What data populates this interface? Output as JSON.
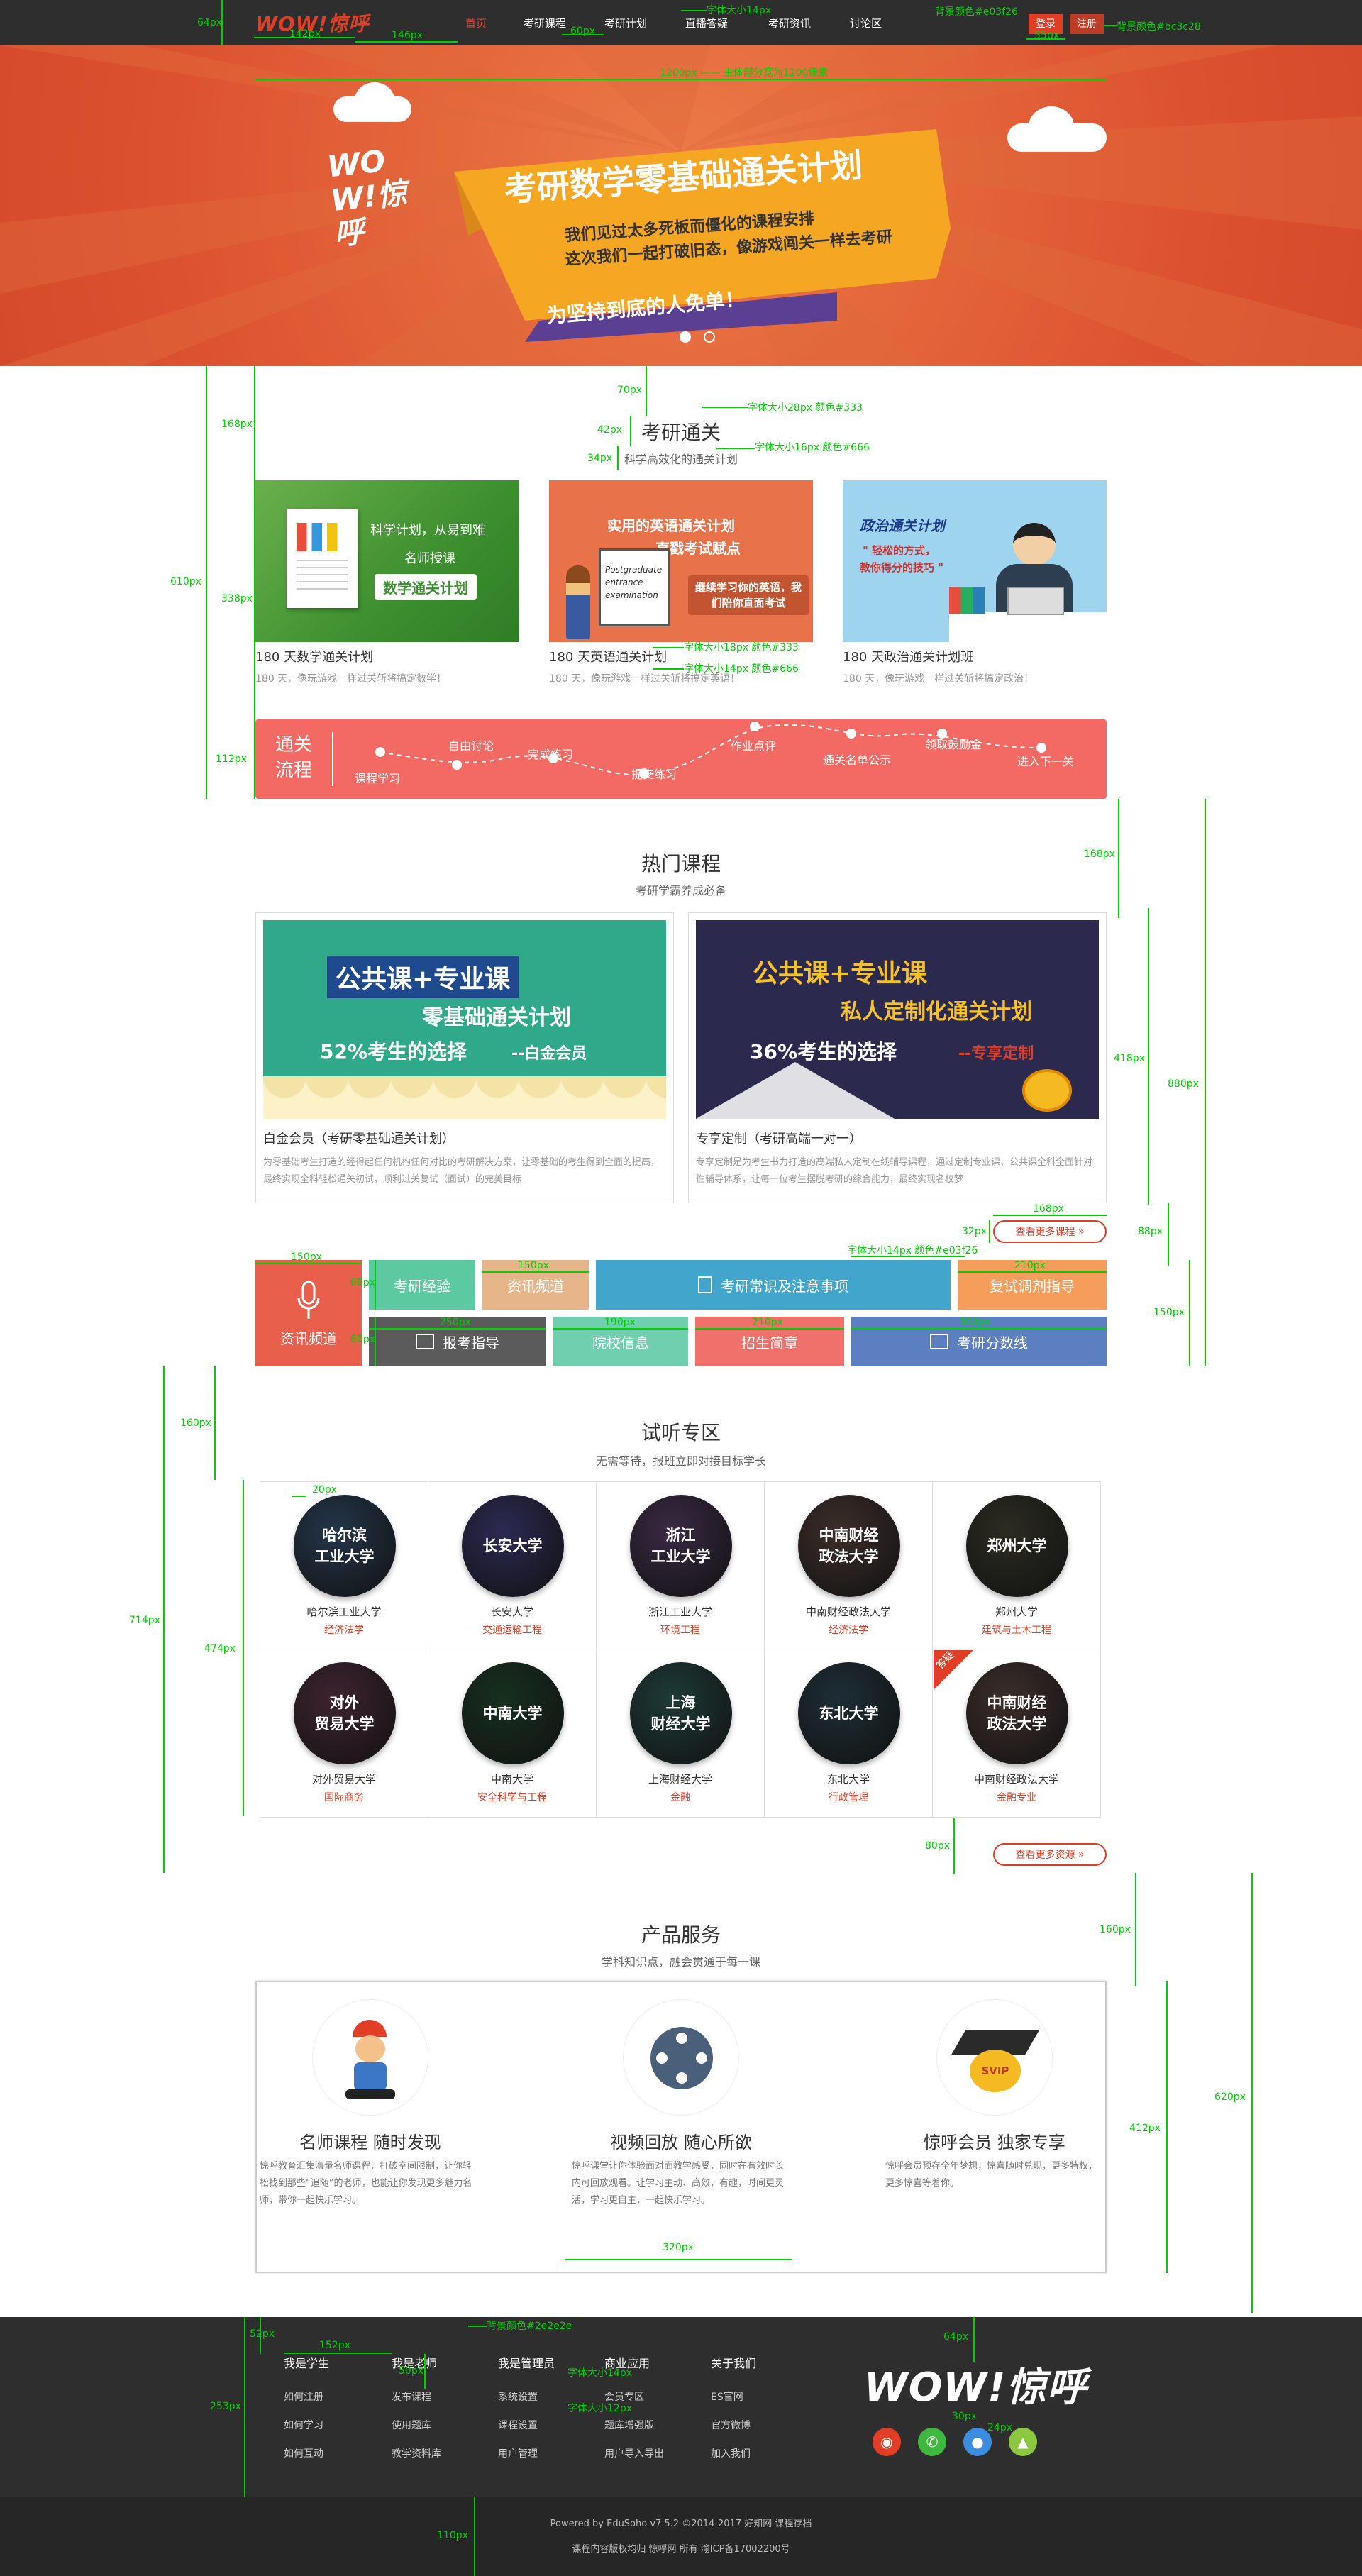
{
  "header": {
    "logo": "WOW!惊呼",
    "nav": [
      "首页",
      "考研课程",
      "考研计划",
      "直播答疑",
      "考研资讯",
      "讨论区"
    ],
    "login": "登录",
    "register": "注册"
  },
  "banner": {
    "title": "考研数学零基础通关计划",
    "line1": "我们见过太多死板而僵化的课程安排",
    "line2": "这次我们一起打破旧态，像游戏闯关一样去考研",
    "ribbon": "为坚持到底的人免单！",
    "logo": "WOW!惊呼"
  },
  "annotations": {
    "m1": "64px",
    "m2": "142px",
    "m3": "146px",
    "m4": "字体大小14px",
    "m5": "60px",
    "m6": "背景颜色#e03f26",
    "m7": "背景颜色#bc3c28",
    "m8": "55px",
    "m9": "1200px —— 主体部分宽为1200像素",
    "m10": "70px",
    "m11": "字体大小28px 颜色#333",
    "m12": "42px",
    "m13": "字体大小16px 颜色#666",
    "m14": "34px",
    "m15": "168px",
    "m16": "610px",
    "m17": "338px",
    "m18": "字体大小18px 颜色#333",
    "m19": "字体大小14px 颜色#666",
    "m20": "112px",
    "m21": "168px",
    "m22": "418px",
    "m23": "880px",
    "m24": "168px",
    "m25": "32px",
    "m26": "88px",
    "m27": "150px",
    "m28": "150px",
    "m29": "210px",
    "m30": "字体大小14px 颜色#e03f26",
    "m31": "150px",
    "m32": "60px",
    "m33": "60px",
    "m34": "250px",
    "m35": "190px",
    "m36": "210px",
    "m37": "360px",
    "m38": "160px",
    "m39": "20px",
    "m40": "714px",
    "m41": "474px",
    "m42": "80px",
    "m43": "160px",
    "m44": "412px",
    "m45": "620px",
    "m46": "320px",
    "m47": "52px",
    "m48": "背景颜色#2e2e2e",
    "m49": "152px",
    "m50": "50px",
    "m51": "字体大小14px",
    "m52": "253px",
    "m53": "字体大小12px",
    "m54": "64px",
    "m55": "30px",
    "m56": "24px",
    "m57": "110px"
  },
  "kaoyan": {
    "title": "考研通关",
    "subtitle": "科学高效化的通关计划",
    "cards": [
      {
        "img_title": "科学计划，从易到难",
        "img_line2": "名师授课",
        "img_tag": "数学通关计划",
        "title": "180 天数学通关计划",
        "desc": "180 天，像玩游戏一样过关斩将搞定数学！"
      },
      {
        "img_title": "实用的英语通关计划",
        "img_line2": "直戳考试赋点",
        "img_tag": "继续学习你的英语，我们陪你直面考试",
        "board": "Postgraduate entrance examination",
        "title": "180 天英语通关计划",
        "desc": "180 天，像玩游戏一样过关斩将搞定英语！"
      },
      {
        "img_title": "政治通关计划",
        "img_line2": "\" 轻松的方式，",
        "img_tag": "教你得分的技巧 \"",
        "title": "180 天政治通关计划班",
        "desc": "180 天，像玩游戏一样过关斩将搞定政治！"
      }
    ],
    "flow": {
      "label": "通关\n流程",
      "steps": [
        "课程学习",
        "自由讨论",
        "完成练习",
        "提交练习",
        "作业点评",
        "通关名单公示",
        "领取鼓励金",
        "进入下一关"
      ]
    }
  },
  "hot": {
    "title": "热门课程",
    "subtitle": "考研学霸养成必备",
    "cards": [
      {
        "banner_l1": "公共课+专业课",
        "banner_l2": "零基础通关计划",
        "banner_l3": "52%考生的选择",
        "banner_l4": "--白金会员",
        "title": "白金会员（考研零基础通关计划）",
        "desc": "为零基础考生打造的经得起任何机构任何对比的考研解决方案，让零基础的考生得到全面的提高，最终实现全科轻松通关初试，顺利过关复试（面试）的完美目标"
      },
      {
        "banner_l1": "公共课+专业课",
        "banner_l2": "私人定制化通关计划",
        "banner_l3": "36%考生的选择",
        "banner_l4": "--专享定制",
        "title": "专享定制（考研高端一对一）",
        "desc": "专享定制是为考生书力打造的高端私人定制在线辅导课程，通过定制专业课、公共课全科全面针对性辅导体系，让每一位考生摆脱考研的综合能力，最终实现名校梦"
      }
    ],
    "more": "查看更多课程",
    "tiles": {
      "big": "资讯频道",
      "r1": [
        "考研经验",
        "资讯频道",
        "考研常识及注意事项",
        "复试调剂指导"
      ],
      "r2": [
        "报考指导",
        "院校信息",
        "招生简章",
        "考研分数线"
      ]
    }
  },
  "trial": {
    "title": "试听专区",
    "subtitle": "无需等待，报班立即对接目标学长",
    "schools": [
      {
        "logo": "哈尔滨\n工业大学",
        "name": "哈尔滨工业大学",
        "major": "经济法学",
        "color": "#24364a"
      },
      {
        "logo": "长安大学",
        "name": "长安大学",
        "major": "交通运输工程",
        "color": "#2b2a52"
      },
      {
        "logo": "浙江\n工业大学",
        "name": "浙江工业大学",
        "major": "环境工程",
        "color": "#3a2a44"
      },
      {
        "logo": "中南财经\n政法大学",
        "name": "中南财经政法大学",
        "major": "经济法学",
        "color": "#3c2e2a"
      },
      {
        "logo": "郑州大学",
        "name": "郑州大学",
        "major": "建筑与土木工程",
        "color": "#2c2c22"
      },
      {
        "logo": "对外\n贸易大学",
        "name": "对外贸易大学",
        "major": "国际商务",
        "color": "#3e2430"
      },
      {
        "logo": "中南大学",
        "name": "中南大学",
        "major": "安全科学与工程",
        "color": "#17301f"
      },
      {
        "logo": "上海\n财经大学",
        "name": "上海财经大学",
        "major": "金融",
        "color": "#1e3a38"
      },
      {
        "logo": "东北大学",
        "name": "东北大学",
        "major": "行政管理",
        "color": "#1e2e36"
      },
      {
        "logo": "中南财经\n政法大学",
        "name": "中南财经政法大学",
        "major": "金融专业",
        "color": "#3c2e2a"
      }
    ],
    "corner": "答疑",
    "more": "查看更多资源"
  },
  "service": {
    "title": "产品服务",
    "subtitle": "学科知识点，融会贯通于每一课",
    "items": [
      {
        "title": "名师课程  随时发现",
        "desc": "惊呼教育汇集海量名师课程，打破空间限制，让你轻松找到那些“追随”的老师，也能让你发现更多魅力名师，带你一起快乐学习。"
      },
      {
        "title": "视频回放  随心所欲",
        "desc": "惊呼课堂让你体验面对面教学感受，同时在有效时长内可回放观看。让学习主动、高效，有趣，时间更灵活，学习更自主，一起快乐学习。"
      },
      {
        "title": "惊呼会员  独家专享",
        "desc": "惊呼会员预存全年梦想，惊喜随时兑现，更多特权，更多惊喜等着你。",
        "badge": "SVIP"
      }
    ]
  },
  "footer": {
    "cols": [
      {
        "head": "我是学生",
        "links": [
          "如何注册",
          "如何学习",
          "如何互动"
        ]
      },
      {
        "head": "我是老师",
        "links": [
          "发布课程",
          "使用题库",
          "教学资料库"
        ]
      },
      {
        "head": "我是管理员",
        "links": [
          "系统设置",
          "课程设置",
          "用户管理"
        ]
      },
      {
        "head": "商业应用",
        "links": [
          "会员专区",
          "题库增强版",
          "用户导入导出"
        ]
      },
      {
        "head": "关于我们",
        "links": [
          "ES官网",
          "官方微博",
          "加入我们"
        ]
      }
    ],
    "logo": "WOW!惊呼",
    "bottom1": "Powered by EduSoho v7.5.2 ©2014-2017   好知网   课程存档",
    "bottom2": "课程内容版权均归 惊呼网 所有   渝ICP备17002200号"
  },
  "colors": {
    "accent": "#e03f26",
    "dark_accent": "#bc3c28",
    "footer_bg": "#2e2e2e",
    "footer_bottom": "#262626"
  }
}
